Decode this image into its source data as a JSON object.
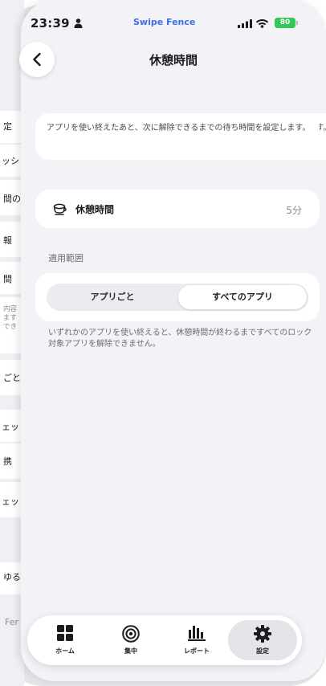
{
  "status_bar": {
    "time": "23:39",
    "app_name": "Swipe Fence",
    "battery": "80"
  },
  "background_page": {
    "fragments": [
      "定",
      "ッシ",
      "間の",
      "報",
      "間",
      "内容",
      "ます",
      "でき",
      "ごと",
      "ェッ",
      "携",
      "ェッ",
      "ゆる",
      "Fer"
    ]
  },
  "nav": {
    "title": "休憩時間"
  },
  "description": "アプリを使い終えたあと、次に解除できるまでの待ち時間を設定します。",
  "rest_row": {
    "icon": "coffee-cup-icon",
    "label": "休憩時間",
    "value": "5分"
  },
  "scope": {
    "section_label": "適用範囲",
    "options": [
      "アプリごと",
      "すべてのアプリ"
    ],
    "selected": "すべてのアプリ",
    "note": "いずれかのアプリを使い終えると、休憩時間が終わるまですべてのロック対象アプリを解除できません。"
  },
  "tabbar": {
    "tabs": [
      {
        "label": "ホーム",
        "icon": "home-grid-icon"
      },
      {
        "label": "集中",
        "icon": "target-icon"
      },
      {
        "label": "レポート",
        "icon": "bar-chart-icon"
      },
      {
        "label": "設定",
        "icon": "gear-icon"
      }
    ],
    "active": "設定"
  }
}
